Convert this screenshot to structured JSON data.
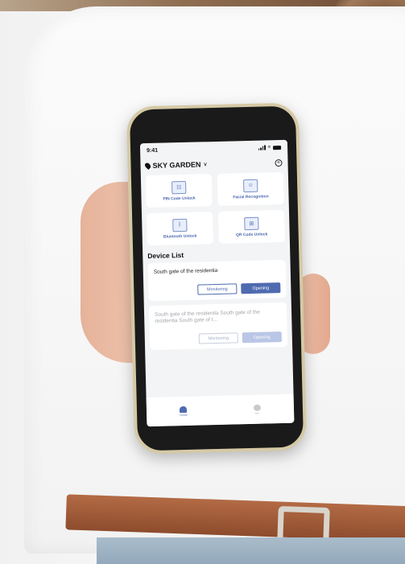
{
  "status_bar": {
    "time": "9:41"
  },
  "header": {
    "community": "SKY GARDEN",
    "chevron": "∨",
    "add_glyph": "+"
  },
  "unlock_methods": [
    {
      "label": "PIN Code Unlock",
      "icon": "keypad-icon",
      "glyph": "☷"
    },
    {
      "label": "Facial Recognition",
      "icon": "face-icon",
      "glyph": "☺"
    },
    {
      "label": "Bluetooth Unlock",
      "icon": "bluetooth-icon",
      "glyph": "ᛒ"
    },
    {
      "label": "QR Code Unlock",
      "icon": "qr-code-icon",
      "glyph": "⊞"
    }
  ],
  "device_list": {
    "title": "Device List",
    "items": [
      {
        "name": "South gate of the residentia",
        "monitor_label": "Monitoring",
        "open_label": "Opening",
        "enabled": true
      },
      {
        "name": "South gate of the residentia South gate of the residentia South gate of t...",
        "monitor_label": "Monitoring",
        "open_label": "Opening",
        "enabled": false
      }
    ]
  },
  "tabbar": {
    "home_label": "Home",
    "me_label": "Me"
  },
  "colors": {
    "accent": "#4f6bb0",
    "screen_bg": "#f3f4f6",
    "muted": "#b9c6e5"
  }
}
